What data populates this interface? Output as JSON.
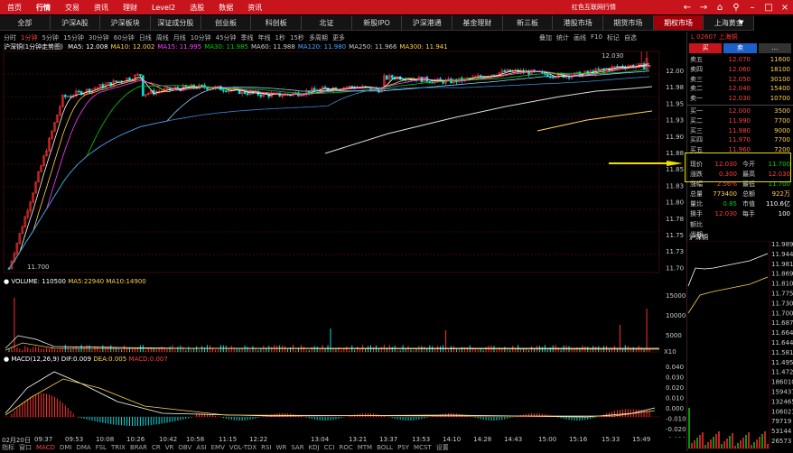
{
  "topbar": {
    "tabs": [
      "首页",
      "行情",
      "交易",
      "资讯",
      "理财",
      "Level2",
      "选股",
      "数据",
      "资讯"
    ],
    "active": 1,
    "title": "红色互联网行情"
  },
  "market_tabs": [
    "全部",
    "沪深A股",
    "沪深板块",
    "深证成分股",
    "创业板",
    "科创板",
    "北证",
    "新股IPO",
    "沪深港通",
    "基金理财",
    "新三板",
    "港股市场",
    "期货市场",
    "期权市场",
    "上海黄金"
  ],
  "market_active": 13,
  "periods": [
    "分时",
    "1分钟",
    "5分钟",
    "15分钟",
    "30分钟",
    "60分钟",
    "日线",
    "周线",
    "月线",
    "10分钟",
    "45分钟",
    "季线",
    "年线",
    "1秒",
    "15秒",
    "多周期",
    "更多"
  ],
  "period_active": 1,
  "tools": [
    "叠加",
    "统计",
    "画线",
    "F10",
    "标记",
    "自选"
  ],
  "main_panel": {
    "label": "沪深铜(1分钟走势图)",
    "ma": [
      {
        "name": "MA5",
        "value": "12.008",
        "color": "#ffffff"
      },
      {
        "name": "MA10",
        "value": "12.002",
        "color": "#ffd24a"
      },
      {
        "name": "MA15",
        "value": "11.995",
        "color": "#ff40ff"
      },
      {
        "name": "MA30",
        "value": "11.985",
        "color": "#00d000"
      },
      {
        "name": "MA60",
        "value": "11.988",
        "color": "#cccccc"
      },
      {
        "name": "MA120",
        "value": "11.980",
        "color": "#4aa8ff"
      },
      {
        "name": "MA250",
        "value": "11.966",
        "color": "#cccccc"
      },
      {
        "name": "MA300",
        "value": "11.941",
        "color": "#ffd24a"
      }
    ],
    "y_ticks": [
      "12.00",
      "11.98",
      "11.95",
      "11.93",
      "11.90",
      "11.88",
      "11.85",
      "11.83",
      "11.80",
      "11.78",
      "11.75",
      "11.73",
      "11.70"
    ],
    "high_label": "12.030",
    "low_label": "11.700"
  },
  "volume_panel": {
    "label": "VOLUME",
    "value": "110500",
    "ma5": "22940",
    "ma10": "14900",
    "y_ticks": [
      "15000",
      "10000",
      "5000"
    ],
    "unit": "X10"
  },
  "macd_panel": {
    "label": "MACD(12,26,9)",
    "dif": "0.009",
    "dea": "0.005",
    "macd": "0.007",
    "y_ticks": [
      "0.040",
      "0.030",
      "0.020",
      "0.010",
      "0.000",
      "-0.010",
      "-0.020",
      "-0.030"
    ]
  },
  "x_labels": [
    "02月20日",
    "09:37",
    "09:53",
    "10:08",
    "10:26",
    "10:42",
    "10:58",
    "11:15",
    "12:22",
    "13:04",
    "13:21",
    "13:37",
    "13:53",
    "14:10",
    "14:28",
    "14:43",
    "15:00",
    "15:16",
    "15:33",
    "15:49"
  ],
  "indicators": [
    "指标",
    "窗口",
    "MACD",
    "DMI",
    "DMA",
    "FSL",
    "TRIX",
    "BRAR",
    "CR",
    "VR",
    "OBV",
    "ASI",
    "EMV",
    "VOL-TDX",
    "RSI",
    "WR",
    "SAR",
    "KDJ",
    "CCI",
    "ROC",
    "MTM",
    "BOLL",
    "PSY",
    "MCST",
    "设置"
  ],
  "indicator_active": 2,
  "quote": {
    "code": "L 02607 上海铜",
    "buy_label": "买",
    "sell_label": "卖",
    "sells": [
      {
        "label": "卖五",
        "price": "12.070",
        "vol": "11600"
      },
      {
        "label": "卖四",
        "price": "12.060",
        "vol": "18100"
      },
      {
        "label": "卖三",
        "price": "12.050",
        "vol": "30100"
      },
      {
        "label": "卖二",
        "price": "12.040",
        "vol": "15400"
      },
      {
        "label": "卖一",
        "price": "12.030",
        "vol": "10700"
      }
    ],
    "buys": [
      {
        "label": "买一",
        "price": "12.000",
        "vol": "3500"
      },
      {
        "label": "买二",
        "price": "11.990",
        "vol": "7700"
      },
      {
        "label": "买三",
        "price": "11.980",
        "vol": "9000"
      },
      {
        "label": "买四",
        "price": "11.970",
        "vol": "7700"
      },
      {
        "label": "买五",
        "price": "11.960",
        "vol": "7200"
      }
    ],
    "stats": [
      {
        "k": "现价",
        "v": "12.030",
        "k2": "今开",
        "v2": "11.700"
      },
      {
        "k": "涨跌",
        "v": "0.300",
        "k2": "最高",
        "v2": "12.030"
      },
      {
        "k": "涨幅",
        "v": "2.56%",
        "k2": "最低",
        "v2": "11.700"
      },
      {
        "k": "总量",
        "v": "773400",
        "k2": "总额",
        "v2": "922万"
      },
      {
        "k": "量比",
        "v": "0.85",
        "k2": "市值",
        "v2": "110.6亿"
      },
      {
        "k": "换手",
        "v": "12.030",
        "k2": "每手",
        "v2": "100"
      }
    ],
    "extra": [
      "额比",
      "当期"
    ]
  },
  "mini": {
    "label": "沪深铜",
    "ticks": [
      "11.989",
      "11.944",
      "11.981",
      "11.869",
      "11.810",
      "11.775",
      "11.730",
      "11.700",
      "11.687",
      "11.664",
      "11.644",
      "11.581",
      "11.495",
      "11.472",
      "186010",
      "159437",
      "132465",
      "106021",
      "79719",
      "53144",
      "26573"
    ]
  }
}
